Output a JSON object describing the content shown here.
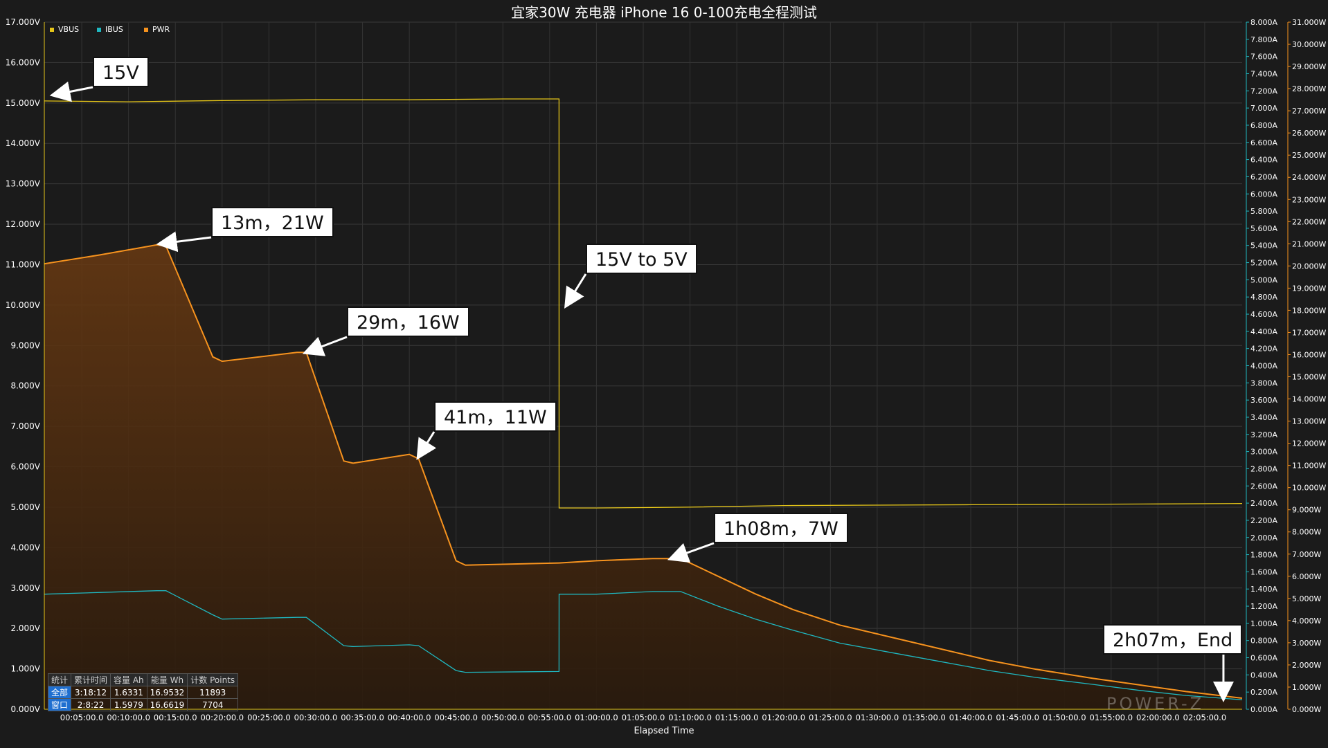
{
  "chart_data": {
    "type": "line",
    "title": "宜家30W 充电器 iPhone 16 0-100充电全程测试",
    "xlabel": "Elapsed Time",
    "x_ticks": [
      "00:05:00.0",
      "00:10:00.0",
      "00:15:00.0",
      "00:20:00.0",
      "00:25:00.0",
      "00:30:00.0",
      "00:35:00.0",
      "00:40:00.0",
      "00:45:00.0",
      "00:50:00.0",
      "00:55:00.0",
      "01:00:00.0",
      "01:05:00.0",
      "01:10:00.0",
      "01:15:00.0",
      "01:20:00.0",
      "01:25:00.0",
      "01:30:00.0",
      "01:35:00.0",
      "01:40:00.0",
      "01:45:00.0",
      "01:50:00.0",
      "01:55:00.0",
      "02:00:00.0",
      "02:05:00.0"
    ],
    "xlim": [
      1.0,
      129.0
    ],
    "axes": {
      "voltage": {
        "ylim": [
          0,
          17
        ],
        "ticks": [
          "0.000V",
          "1.000V",
          "2.000V",
          "3.000V",
          "4.000V",
          "5.000V",
          "6.000V",
          "7.000V",
          "8.000V",
          "9.000V",
          "10.000V",
          "11.000V",
          "12.000V",
          "13.000V",
          "14.000V",
          "15.000V",
          "16.000V",
          "17.000V"
        ]
      },
      "current": {
        "ylim": [
          0,
          8
        ],
        "ticks": [
          "0.000A",
          "0.200A",
          "0.400A",
          "0.600A",
          "0.800A",
          "1.000A",
          "1.200A",
          "1.400A",
          "1.600A",
          "1.800A",
          "2.000A",
          "2.200A",
          "2.400A",
          "2.600A",
          "2.800A",
          "3.000A",
          "3.200A",
          "3.400A",
          "3.600A",
          "3.800A",
          "4.000A",
          "4.200A",
          "4.400A",
          "4.600A",
          "4.800A",
          "5.000A",
          "5.200A",
          "5.400A",
          "5.600A",
          "5.800A",
          "6.000A",
          "6.200A",
          "6.400A",
          "6.600A",
          "6.800A",
          "7.000A",
          "7.200A",
          "7.400A",
          "7.600A",
          "7.800A",
          "8.000A"
        ]
      },
      "power": {
        "ylim": [
          0,
          31
        ],
        "ticks": [
          "0.000W",
          "1.000W",
          "2.000W",
          "3.000W",
          "4.000W",
          "5.000W",
          "6.000W",
          "7.000W",
          "8.000W",
          "9.000W",
          "10.000W",
          "11.000W",
          "12.000W",
          "13.000W",
          "14.000W",
          "15.000W",
          "16.000W",
          "17.000W",
          "18.000W",
          "19.000W",
          "20.000W",
          "21.000W",
          "22.000W",
          "23.000W",
          "24.000W",
          "25.000W",
          "26.000W",
          "27.000W",
          "28.000W",
          "29.000W",
          "30.000W",
          "31.000W"
        ]
      }
    },
    "grid": true,
    "legend_position": "top-left",
    "series": [
      {
        "name": "VBUS",
        "axis": "voltage",
        "color": "#e6c619",
        "x": [
          1.0,
          10,
          20,
          30,
          40,
          50,
          56,
          56.01,
          60,
          70,
          80,
          90,
          100,
          110,
          120,
          129
        ],
        "y": [
          15.05,
          15.03,
          15.06,
          15.08,
          15.08,
          15.1,
          15.1,
          4.98,
          4.98,
          5.0,
          5.04,
          5.05,
          5.06,
          5.07,
          5.08,
          5.09
        ]
      },
      {
        "name": "IBUS",
        "axis": "current",
        "color": "#1fb8c1",
        "x": [
          1.0,
          7,
          13,
          14,
          19,
          20,
          28,
          29,
          33,
          34,
          40,
          41,
          45,
          46,
          56,
          56.01,
          60,
          66,
          69,
          73,
          77,
          81,
          86,
          92,
          97,
          102,
          107,
          113,
          118,
          123,
          129
        ],
        "y": [
          1.34,
          1.36,
          1.38,
          1.38,
          1.1,
          1.05,
          1.07,
          1.07,
          0.74,
          0.73,
          0.75,
          0.74,
          0.45,
          0.43,
          0.44,
          1.34,
          1.34,
          1.37,
          1.37,
          1.2,
          1.05,
          0.92,
          0.77,
          0.65,
          0.55,
          0.45,
          0.37,
          0.29,
          0.22,
          0.16,
          0.11
        ]
      },
      {
        "name": "PWR",
        "axis": "power",
        "color": "#f7931e",
        "x": [
          1.0,
          7,
          13,
          14,
          19,
          20,
          28,
          29,
          33,
          34,
          40,
          41,
          45,
          46,
          56,
          56.01,
          60,
          66,
          69,
          73,
          77,
          81,
          86,
          92,
          97,
          102,
          107,
          113,
          118,
          123,
          129
        ],
        "y": [
          20.1,
          20.5,
          20.95,
          20.9,
          15.9,
          15.7,
          16.1,
          16.1,
          11.2,
          11.1,
          11.5,
          11.3,
          6.7,
          6.5,
          6.6,
          6.6,
          6.7,
          6.8,
          6.8,
          6.0,
          5.2,
          4.5,
          3.8,
          3.2,
          2.7,
          2.2,
          1.8,
          1.4,
          1.1,
          0.8,
          0.5
        ]
      }
    ],
    "annotations": [
      {
        "text": "15V",
        "target_x": 2.0,
        "target_y": 15.2,
        "axis": "voltage"
      },
      {
        "text": "13m，21W",
        "target_x": 13.4,
        "target_y": 21.0,
        "axis": "power"
      },
      {
        "text": "29m，16W",
        "target_x": 29.0,
        "target_y": 16.1,
        "axis": "power"
      },
      {
        "text": "41m，11W",
        "target_x": 41.0,
        "target_y": 11.4,
        "axis": "power"
      },
      {
        "text": "15V to 5V",
        "target_x": 56.8,
        "target_y": 10.0,
        "axis": "voltage"
      },
      {
        "text": "1h08m，7W",
        "target_x": 68.0,
        "target_y": 6.8,
        "axis": "power"
      },
      {
        "text": "2h07m，End",
        "target_x": 127.0,
        "target_y": 0.5,
        "axis": "power"
      }
    ]
  },
  "stats_table": {
    "headers": [
      "统计",
      "累计时间",
      "容量 Ah",
      "能量 Wh",
      "计数 Points"
    ],
    "rows": [
      {
        "label": "全部",
        "time": "3:18:12",
        "capacity": "1.6331",
        "energy": "16.9532",
        "points": "11893"
      },
      {
        "label": "窗口",
        "time": "2:8:22",
        "capacity": "1.5979",
        "energy": "16.6619",
        "points": "7704"
      }
    ]
  },
  "watermark": "POWER-Z"
}
